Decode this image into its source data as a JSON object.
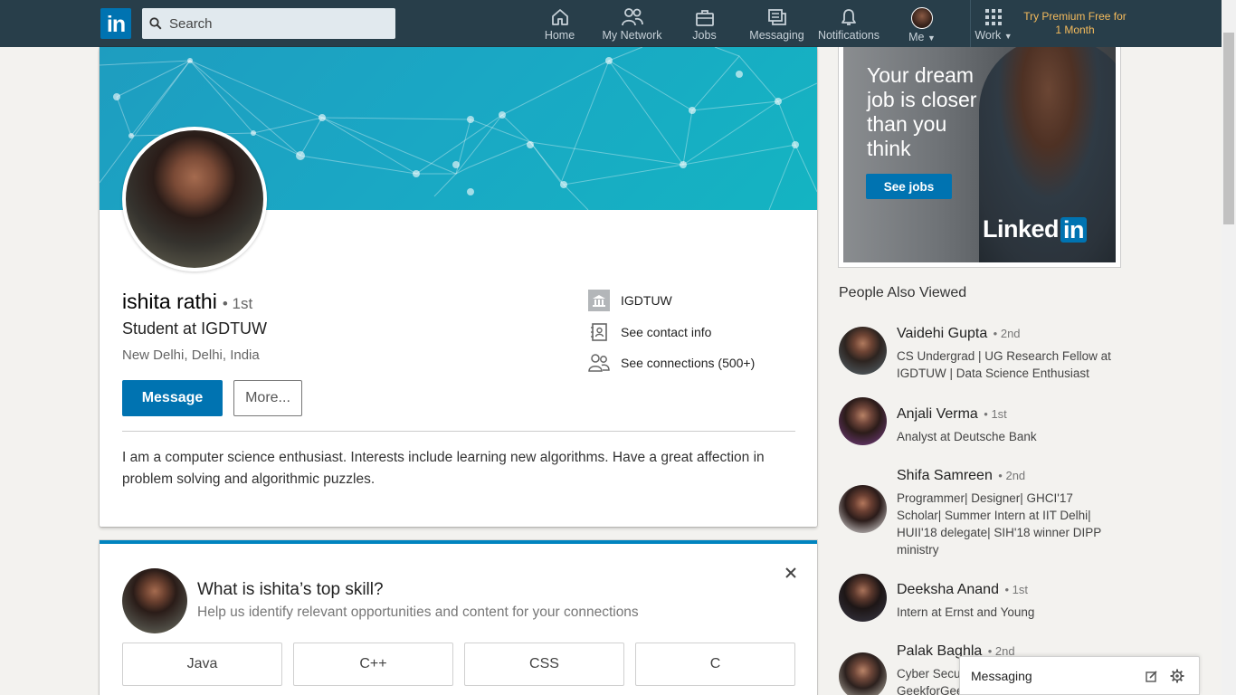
{
  "nav": {
    "logo": "in",
    "search_placeholder": "Search",
    "items": [
      {
        "label": "Home",
        "icon": "home-icon"
      },
      {
        "label": "My Network",
        "icon": "network-icon"
      },
      {
        "label": "Jobs",
        "icon": "briefcase-icon"
      },
      {
        "label": "Messaging",
        "icon": "messaging-icon"
      },
      {
        "label": "Notifications",
        "icon": "bell-icon"
      },
      {
        "label": "Me",
        "icon": "avatar"
      },
      {
        "label": "Work",
        "icon": "grid-icon"
      }
    ],
    "premium": "Try Premium Free for 1 Month"
  },
  "profile": {
    "name": "ishita rathi",
    "degree": "• 1st",
    "headline": "Student at IGDTUW",
    "location": "New Delhi, Delhi, India",
    "message_button": "Message",
    "more_button": "More...",
    "school": "IGDTUW",
    "contact_info": "See contact info",
    "connections": "See connections (500+)",
    "summary": "I am a computer science enthusiast. Interests include learning new algorithms. Have a great affection in problem solving and algorithmic puzzles."
  },
  "skills_card": {
    "question": "What is ishita’s top skill?",
    "subtitle": "Help us identify relevant opportunities and content for your connections",
    "options": [
      "Java",
      "C++",
      "CSS",
      "C"
    ]
  },
  "ad": {
    "text": "Your dream job is closer than you think",
    "button": "See jobs",
    "logo_text": "Linked",
    "logo_in": "in"
  },
  "people_also_viewed": {
    "title": "People Also Viewed",
    "people": [
      {
        "name": "Vaidehi Gupta",
        "degree": "• 2nd",
        "headline": "CS Undergrad | UG Research Fellow at IGDTUW | Data Science Enthusiast"
      },
      {
        "name": "Anjali Verma",
        "degree": "• 1st",
        "headline": "Analyst at Deutsche Bank"
      },
      {
        "name": "Shifa Samreen",
        "degree": "• 2nd",
        "headline": "Programmer| Designer| GHCI'17 Scholar| Summer Intern at IIT Delhi| HUII'18 delegate| SIH'18 winner DIPP ministry"
      },
      {
        "name": "Deeksha Anand",
        "degree": "• 1st",
        "headline": "Intern at Ernst and Young"
      },
      {
        "name": "Palak Baghla",
        "degree": "• 2nd",
        "headline": "Cyber Security | GeekforGeeks"
      }
    ]
  },
  "messaging": {
    "label": "Messaging"
  },
  "colors": {
    "nav_bg": "#283e4a",
    "brand_blue": "#0073b1",
    "premium_gold": "#f5bb5c"
  }
}
